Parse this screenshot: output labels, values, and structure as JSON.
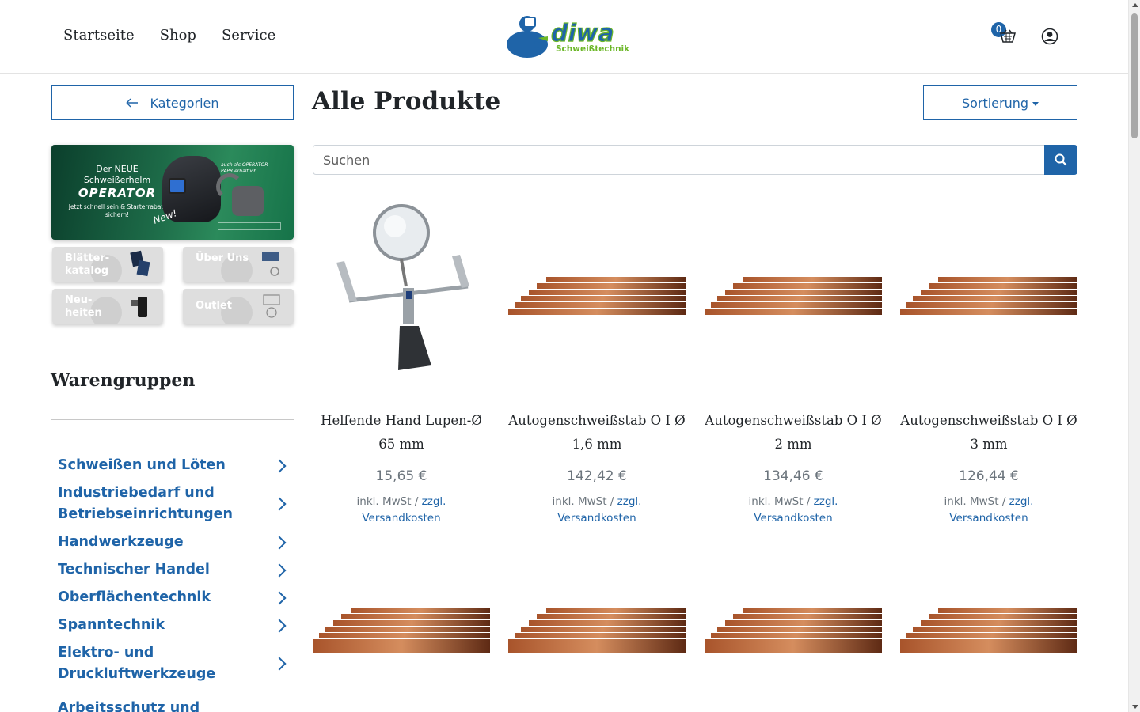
{
  "header": {
    "nav": [
      "Startseite",
      "Shop",
      "Service"
    ],
    "logo_text": "diwa",
    "logo_subtitle": "Schweißtechnik",
    "cart_count": "0",
    "icons": [
      "cart-icon",
      "user-icon"
    ]
  },
  "sidebar": {
    "categories_button": "Kategorien",
    "banner": {
      "line1": "Der NEUE Schweißerhelm",
      "brand": "OPERATOR",
      "line3": "Jetzt schnell sein & Starterrabatt sichern!",
      "side_note": "auch als OPERATOR PAPR erhältlich",
      "badge": "New!"
    },
    "tiles": [
      {
        "label": "Blätter-katalog"
      },
      {
        "label": "Über Uns"
      },
      {
        "label": "Neu-heiten"
      },
      {
        "label": "Outlet"
      }
    ],
    "section_title": "Warengruppen",
    "categories": [
      "Schweißen und Löten",
      "Industriebedarf und Betriebseinrichtungen",
      "Handwerkzeuge",
      "Technischer Handel",
      "Oberflächentechnik",
      "Spanntechnik",
      "Elektro- und Druckluftwerkzeuge",
      "Arbeitsschutz und"
    ]
  },
  "main": {
    "title": "Alle Produkte",
    "sort_label": "Sortierung",
    "search_placeholder": "Suchen",
    "tax_prefix": "inkl. MwSt /",
    "tax_link_1": "zzgl.",
    "tax_link_2": "Versandkosten",
    "products": [
      {
        "name": "Helfende Hand Lupen-Ø 65 mm",
        "price": "15,65 €",
        "image": "third-hand-magnifier"
      },
      {
        "name": "Autogenschweißstab O I Ø 1,6 mm",
        "price": "142,42 €",
        "image": "copper-rods"
      },
      {
        "name": "Autogenschweißstab O I Ø 2 mm",
        "price": "134,46 €",
        "image": "copper-rods"
      },
      {
        "name": "Autogenschweißstab O I Ø 3 mm",
        "price": "126,44 €",
        "image": "copper-rods"
      }
    ]
  },
  "colors": {
    "accent": "#1f64a8",
    "logo_green": "#6cb728",
    "price_gray": "#6c757d"
  }
}
